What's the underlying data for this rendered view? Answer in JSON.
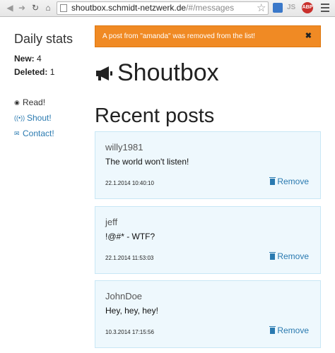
{
  "browser": {
    "url_host": "shoutbox.schmidt-netzwerk.de",
    "url_path": "/#/messages",
    "ext_abp_label": "ABP",
    "ext_js_label": "JS",
    "icons": [
      "back-icon",
      "forward-icon",
      "reload-icon",
      "home-icon",
      "star-icon",
      "menu-icon"
    ]
  },
  "sidebar": {
    "title": "Daily stats",
    "new_label": "New:",
    "new_value": "4",
    "deleted_label": "Deleted:",
    "deleted_value": "1",
    "nav": [
      {
        "label": "Read!",
        "icon": "eye-icon"
      },
      {
        "label": "Shout!",
        "icon": "broadcast-icon"
      },
      {
        "label": "Contact!",
        "icon": "envelope-icon"
      }
    ]
  },
  "alert": {
    "message": "A post from \"amanda\" was removed from the list!",
    "close_label": "✖"
  },
  "header": {
    "title": "Shoutbox",
    "icon": "megaphone-icon"
  },
  "recent_title": "Recent posts",
  "posts": [
    {
      "author": "willy1981",
      "text": "The world won't listen!",
      "time": "22.1.2014 10:40:10",
      "remove_label": "Remove"
    },
    {
      "author": "jeff",
      "text": "!@#* - WTF?",
      "time": "22.1.2014 11:53:03",
      "remove_label": "Remove"
    },
    {
      "author": "JohnDoe",
      "text": "Hey, hey, hey!",
      "time": "10.3.2014 17:15:56",
      "remove_label": "Remove"
    }
  ],
  "colors": {
    "alert_bg": "#f08a24",
    "post_bg": "#eef8fd",
    "link": "#2a7ab0"
  }
}
